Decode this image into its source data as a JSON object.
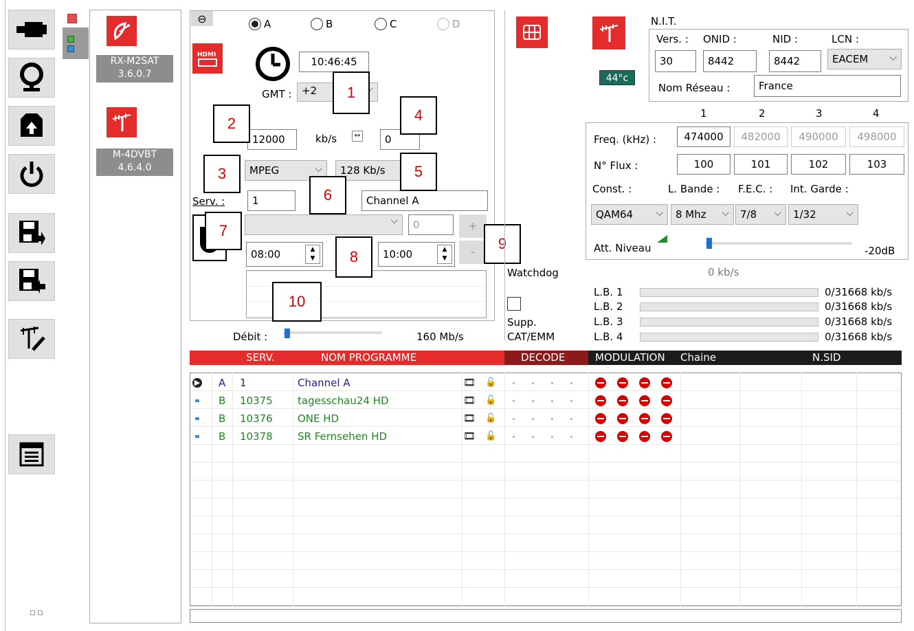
{
  "sidebar": {
    "buttons": [
      "usb-icon",
      "globe-icon",
      "package-icon",
      "power-icon",
      "save-export-icon",
      "save-import-icon",
      "antenna-tools-icon",
      "list-window-icon"
    ]
  },
  "status": {
    "alarm_color": "#e05050",
    "leds": [
      "#44b044",
      "#3c8ad8"
    ]
  },
  "devices": [
    {
      "name": "RX-M2SAT",
      "version": "3.6.0.7"
    },
    {
      "name": "M-4DVBT",
      "version": "4.6.4.0"
    }
  ],
  "input": {
    "radios": [
      "A",
      "B",
      "C",
      "D"
    ],
    "selected": "A",
    "time": "10:46:45",
    "gmt_label": "GMT :",
    "gmt_value": "+2",
    "bitrate": "12000",
    "bitrate_unit": "kb/s",
    "offset": "0",
    "codec": "MPEG",
    "audio_rate": "128 Kb/s",
    "serv_label": "Serv. :",
    "serv_value": "1",
    "name_value": "Channel A",
    "prog_value": "0",
    "time_start": "08:00",
    "time_end": "10:00",
    "plus": "+",
    "minus": "-",
    "debit_label": "Débit :",
    "debit_value": "160 Mb/s"
  },
  "callouts": [
    "1",
    "2",
    "3",
    "4",
    "5",
    "6",
    "7",
    "8",
    "9",
    "10"
  ],
  "mid": {
    "watchdog": "Watchdog",
    "supp": "Supp.",
    "cat": "CAT/EMM"
  },
  "nit": {
    "title": "N.I.T.",
    "vers_label": "Vers. :",
    "onid_label": "ONID :",
    "nid_label": "NID :",
    "lcn_label": "LCN :",
    "vers": "30",
    "onid": "8442",
    "nid": "8442",
    "lcn": "EACEM",
    "nom_label": "Nom Réseau :",
    "nom": "France",
    "temp": "44°c"
  },
  "mod": {
    "cols": [
      "1",
      "2",
      "3",
      "4"
    ],
    "freq_label": "Freq. (kHz) :",
    "freqs": [
      "474000",
      "482000",
      "490000",
      "498000"
    ],
    "flux_label": "N° Flux :",
    "flux": [
      "100",
      "101",
      "102",
      "103"
    ],
    "const_label": "Const. :",
    "lb_label": "L. Bande :",
    "fec_label": "F.E.C. :",
    "garde_label": "Int. Garde :",
    "const": "QAM64",
    "bande": "8 Mhz",
    "fec": "7/8",
    "garde": "1/32",
    "att_label": "Att. Niveau",
    "att_value": "-20dB",
    "rate": "0 kb/s"
  },
  "lb": [
    {
      "label": "L.B. 1",
      "value": "0/31668 kb/s"
    },
    {
      "label": "L.B. 2",
      "value": "0/31668 kb/s"
    },
    {
      "label": "L.B. 3",
      "value": "0/31668 kb/s"
    },
    {
      "label": "L.B. 4",
      "value": "0/31668 kb/s"
    }
  ],
  "table": {
    "h_serv": "SERV.",
    "h_nom": "NOM PROGRAMME",
    "h_decode": "DECODE",
    "h_mod": "MODULATION",
    "h_chaine": "Chaine",
    "h_nsid": "N.SID",
    "rows": [
      {
        "src": "A",
        "serv": "1",
        "nom": "Channel A",
        "color": "#1f1f8f"
      },
      {
        "src": "B",
        "serv": "10375",
        "nom": "tagesschau24 HD",
        "color": "#1e8a1e"
      },
      {
        "src": "B",
        "serv": "10376",
        "nom": "ONE HD",
        "color": "#1e8a1e"
      },
      {
        "src": "B",
        "serv": "10378",
        "nom": "SR Fernsehen HD",
        "color": "#1e8a1e"
      }
    ]
  },
  "colors": {
    "red": "#e42c2c",
    "dark": "#1c1c1c",
    "darkred": "#8c1a1a",
    "teal": "#1b6b5a"
  }
}
